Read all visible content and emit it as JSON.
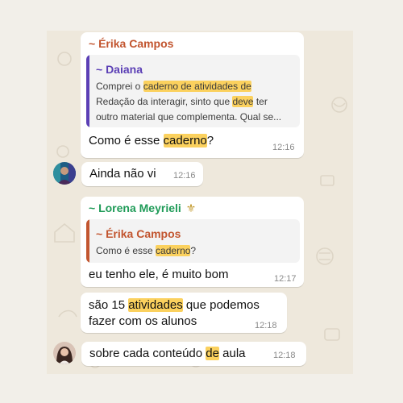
{
  "colors": {
    "page_bg": "#f2efe9",
    "chat_bg": "#eee8dc",
    "bubble_bg": "#ffffff",
    "highlight": "#fbd15e",
    "sender_erika": "#c2552f",
    "sender_lorena": "#1f9b58",
    "quote_bar_daiana": "#5b3fb5",
    "quote_bar_erika": "#c2552f",
    "timestamp": "#8a8a8a"
  },
  "messages": [
    {
      "sender": "~ Érika Campos",
      "quote": {
        "author": "~ Daiana",
        "line1_a": "Comprei o ",
        "line1_hl1": "caderno de atividades de",
        "line2_a": "Redação da interagir, sinto que ",
        "line2_hl": "deve",
        "line2_b": " ter",
        "line3": "outro material que complementa. Qual se..."
      },
      "text_a": "Como é esse ",
      "text_hl": "caderno",
      "text_b": "?",
      "time": "12:16"
    },
    {
      "avatar": "avatar-lorena",
      "text": "Ainda não vi",
      "time": "12:16"
    },
    {
      "sender": "~ Lorena Meyrieli",
      "sender_icon": "fleur-de-lis-icon",
      "sender_icon_glyph": "⚜",
      "quote": {
        "author": "~ Érika Campos",
        "line1_a": "Como é esse ",
        "line1_hl": "caderno",
        "line1_b": "?"
      },
      "text": "eu tenho ele, é muito bom",
      "time": "12:17"
    },
    {
      "line1_a": "são 15 ",
      "line1_hl": "atividades",
      "line1_b": " que podemos",
      "line2": "fazer com os alunos",
      "time": "12:18"
    },
    {
      "avatar": "avatar-lorena",
      "text_a": "sobre cada conteúdo ",
      "text_hl": "de",
      "text_b": " aula",
      "time": "12:18"
    }
  ]
}
